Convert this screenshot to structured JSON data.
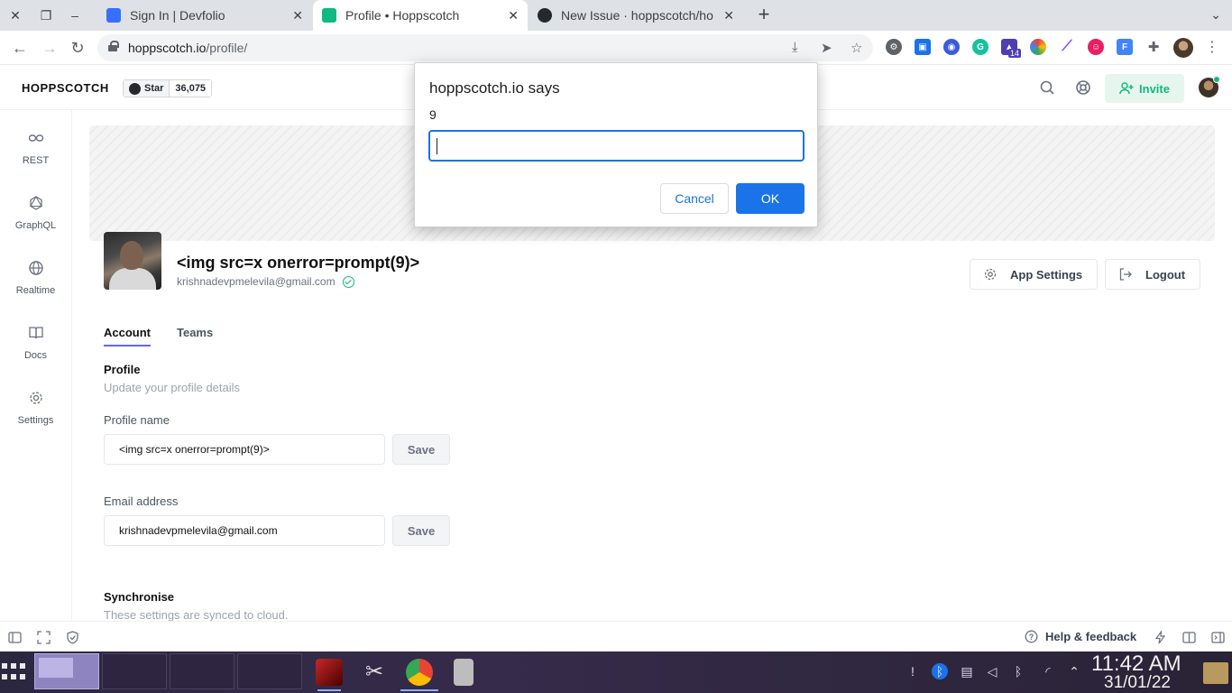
{
  "browser": {
    "tabs": [
      {
        "title": "Sign In | Devfolio",
        "favicon_color": "#3770ff"
      },
      {
        "title": "Profile • Hoppscotch",
        "favicon_color": "#10b981"
      },
      {
        "title": "New Issue · hoppscotch/ho",
        "favicon_color": "#24292e"
      }
    ],
    "url_host": "hoppscotch.io",
    "url_path": "/profile/",
    "extension_badge": "14"
  },
  "app": {
    "brand": "HOPPSCOTCH",
    "github_star_label": "Star",
    "github_star_count": "36,075",
    "invite_label": "Invite",
    "accent_color": "#10b981"
  },
  "sidenav": {
    "items": [
      {
        "label": "REST",
        "icon": "link-icon"
      },
      {
        "label": "GraphQL",
        "icon": "graphql-icon"
      },
      {
        "label": "Realtime",
        "icon": "globe-icon"
      },
      {
        "label": "Docs",
        "icon": "book-icon"
      },
      {
        "label": "Settings",
        "icon": "gear-icon"
      }
    ]
  },
  "profile": {
    "display_name": "<img src=x onerror=prompt(9)>",
    "email": "krishnadevpmelevila@gmail.com",
    "app_settings_label": "App Settings",
    "logout_label": "Logout",
    "tabs": [
      "Account",
      "Teams"
    ],
    "section_title": "Profile",
    "section_subtitle": "Update your profile details",
    "name_label": "Profile name",
    "name_value": "<img src=x onerror=prompt(9)>",
    "email_label": "Email address",
    "email_value": "krishnadevpmelevila@gmail.com",
    "save_label": "Save",
    "sync_title": "Synchronise",
    "sync_subtitle": "These settings are synced to cloud."
  },
  "footer": {
    "help_label": "Help & feedback"
  },
  "dialog": {
    "title": "hoppscotch.io says",
    "message": "9",
    "input_value": "",
    "cancel_label": "Cancel",
    "ok_label": "OK"
  },
  "shelf": {
    "time": "11:42 AM",
    "date": "31/01/22"
  }
}
